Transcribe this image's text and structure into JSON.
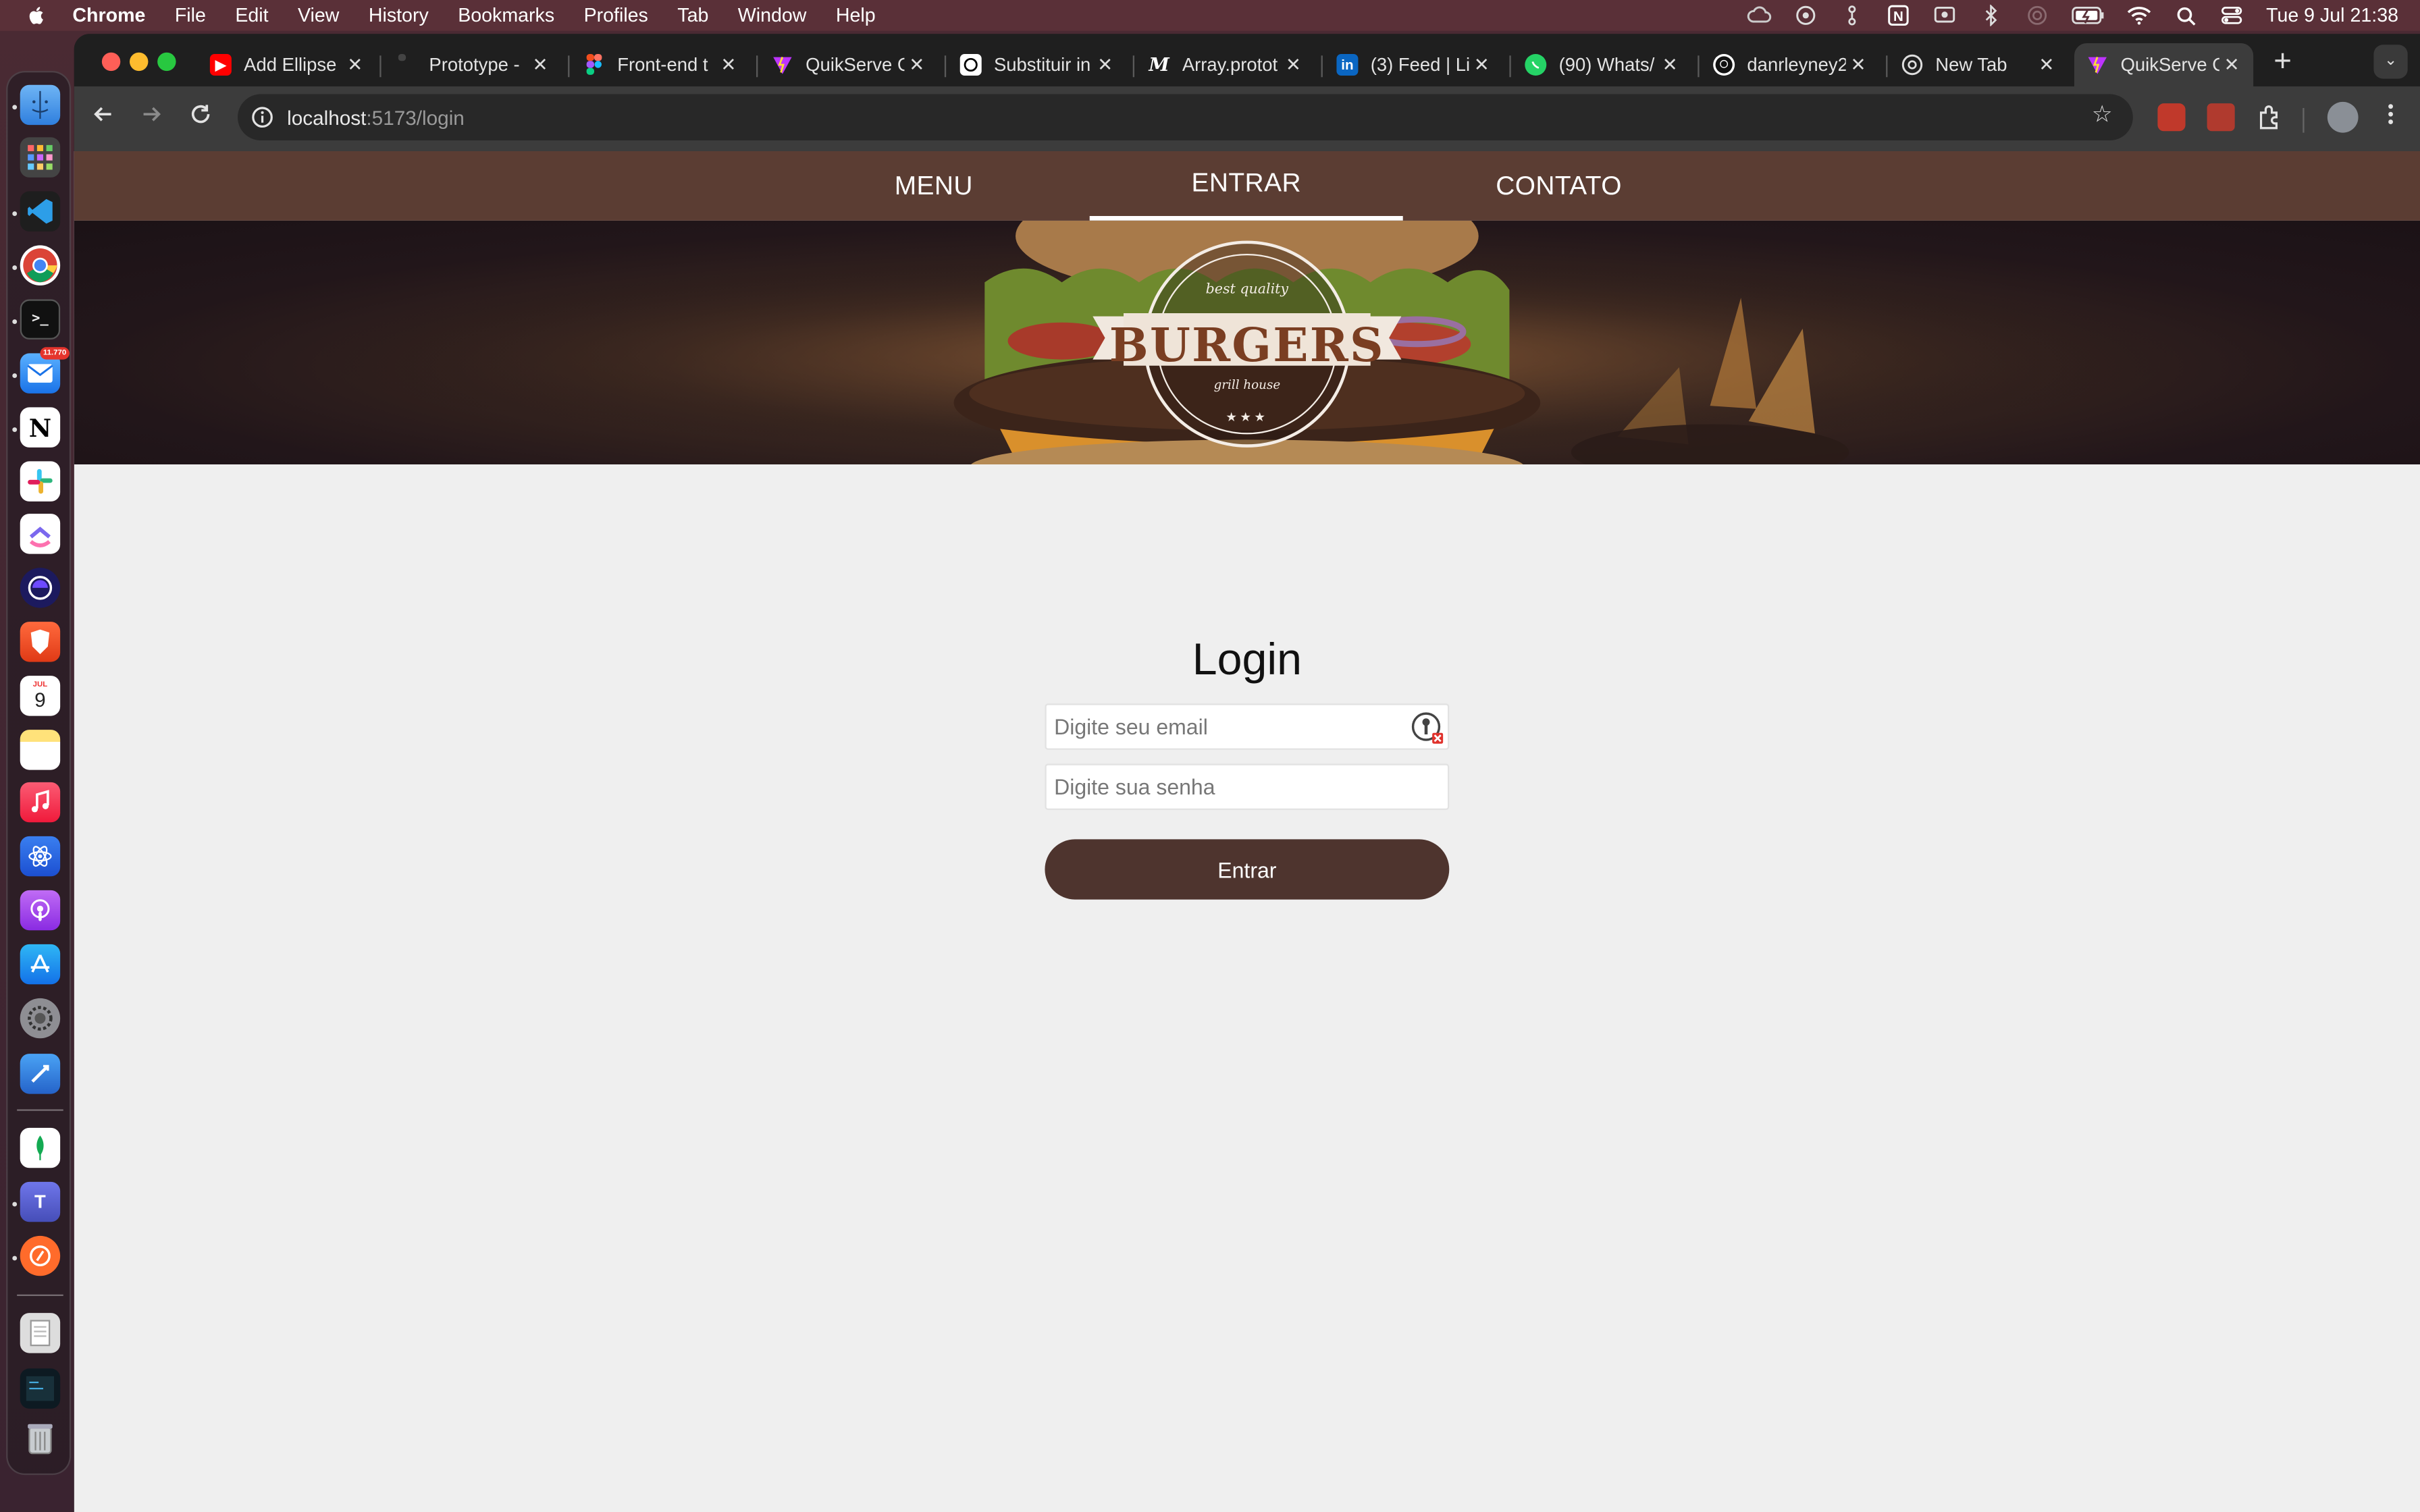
{
  "menubar": {
    "app_name": "Chrome",
    "items": [
      "File",
      "Edit",
      "View",
      "History",
      "Bookmarks",
      "Profiles",
      "Tab",
      "Window",
      "Help"
    ],
    "clock": "Tue 9 Jul  21:38"
  },
  "dock": {
    "mail_badge": "11.770",
    "calendar_month": "JUL",
    "calendar_day": "9"
  },
  "browser": {
    "tabs": [
      {
        "title": "Add Ellipse",
        "icon": "youtube-icon",
        "color": "#ff0000"
      },
      {
        "title": "Prototype -",
        "icon": "figma-icon",
        "color": "#1e1e1e"
      },
      {
        "title": "Front-end t",
        "icon": "figma-icon",
        "color": "#a259ff"
      },
      {
        "title": "QuikServe C",
        "icon": "vite-icon",
        "color": "#bd34fe"
      },
      {
        "title": "Substituir in",
        "icon": "openai-icon",
        "color": "#ffffff"
      },
      {
        "title": "Array.protot",
        "icon": "mdn-icon",
        "color": "#ffffff"
      },
      {
        "title": "(3) Feed | Li",
        "icon": "linkedin-icon",
        "color": "#0a66c2"
      },
      {
        "title": "(90) Whats/",
        "icon": "whatsapp-icon",
        "color": "#25d366"
      },
      {
        "title": "danrleyney2",
        "icon": "github-icon",
        "color": "#ffffff"
      },
      {
        "title": "New Tab",
        "icon": "chrome-icon",
        "color": "#ffffff"
      },
      {
        "title": "QuikServe C",
        "icon": "vite-icon",
        "color": "#bd34fe",
        "active": true
      }
    ],
    "url_host": "localhost",
    "url_path": ":5173/login"
  },
  "site": {
    "nav": {
      "menu": "MENU",
      "entrar": "ENTRAR",
      "contato": "CONTATO"
    },
    "logo": {
      "top_text": "best quality",
      "main_text": "BURGERS",
      "bottom_text": "grill house",
      "stars": "★★★"
    },
    "login": {
      "title": "Login",
      "email_placeholder": "Digite seu email",
      "password_placeholder": "Digite sua senha",
      "submit_label": "Entrar"
    }
  }
}
